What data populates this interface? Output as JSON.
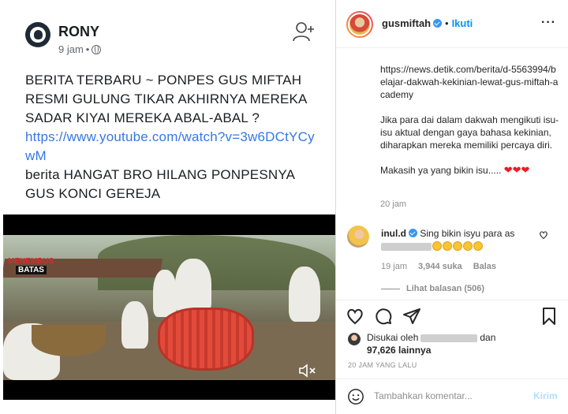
{
  "facebook_post": {
    "author": "RONY",
    "time": "9 jam",
    "separator": "•",
    "text_line1": "BERITA TERBARU ~ PONPES GUS MIFTAH RESMI GULUNG TIKAR AKHIRNYA MEREKA SADAR KIYAI MEREKA ABAL-ABAL ?",
    "link": "https://www.youtube.com/watch?v=3w6DCtYCywM",
    "text_line2": "berita HANGAT BRO HILANG PONPESNYA GUS KONCI GEREJA",
    "video_logo_line1a": "MENEM",
    "video_logo_line1b": "BUS",
    "video_logo_line2": "BATAS"
  },
  "instagram": {
    "username": "gusmiftah",
    "follow_separator": "•",
    "follow_label": "Ikuti",
    "more_label": "···",
    "caption_url": "https://news.detik.com/berita/d-5563994/belajar-dakwah-kekinian-lewat-gus-miftah-academy",
    "caption_p2": "Jika para dai dalam dakwah mengikuti isu-isu aktual dengan gaya bahasa kekinian, diharapkan mereka memiliki percaya diri.",
    "caption_p3": "Makasih ya yang bikin isu.....",
    "caption_hearts": "❤❤❤",
    "caption_time": "20 jam",
    "comment": {
      "user": "inul.d",
      "text_before": "Sing bikin isyu para",
      "text_prefix": "as",
      "time": "19 jam",
      "likes": "3,944 suka",
      "reply_label": "Balas",
      "view_replies": "Lihat balasan (506)"
    },
    "liked_by_prefix": "Disukai oleh",
    "liked_by_and": "dan",
    "liked_count": "97,626 lainnya",
    "post_time": "20 JAM YANG LALU",
    "add_comment_placeholder": "Tambahkan komentar...",
    "send_label": "Kirim"
  },
  "colors": {
    "link_blue": "#3578e5",
    "ig_blue": "#0095f6",
    "heart_red": "#ed1c24"
  }
}
